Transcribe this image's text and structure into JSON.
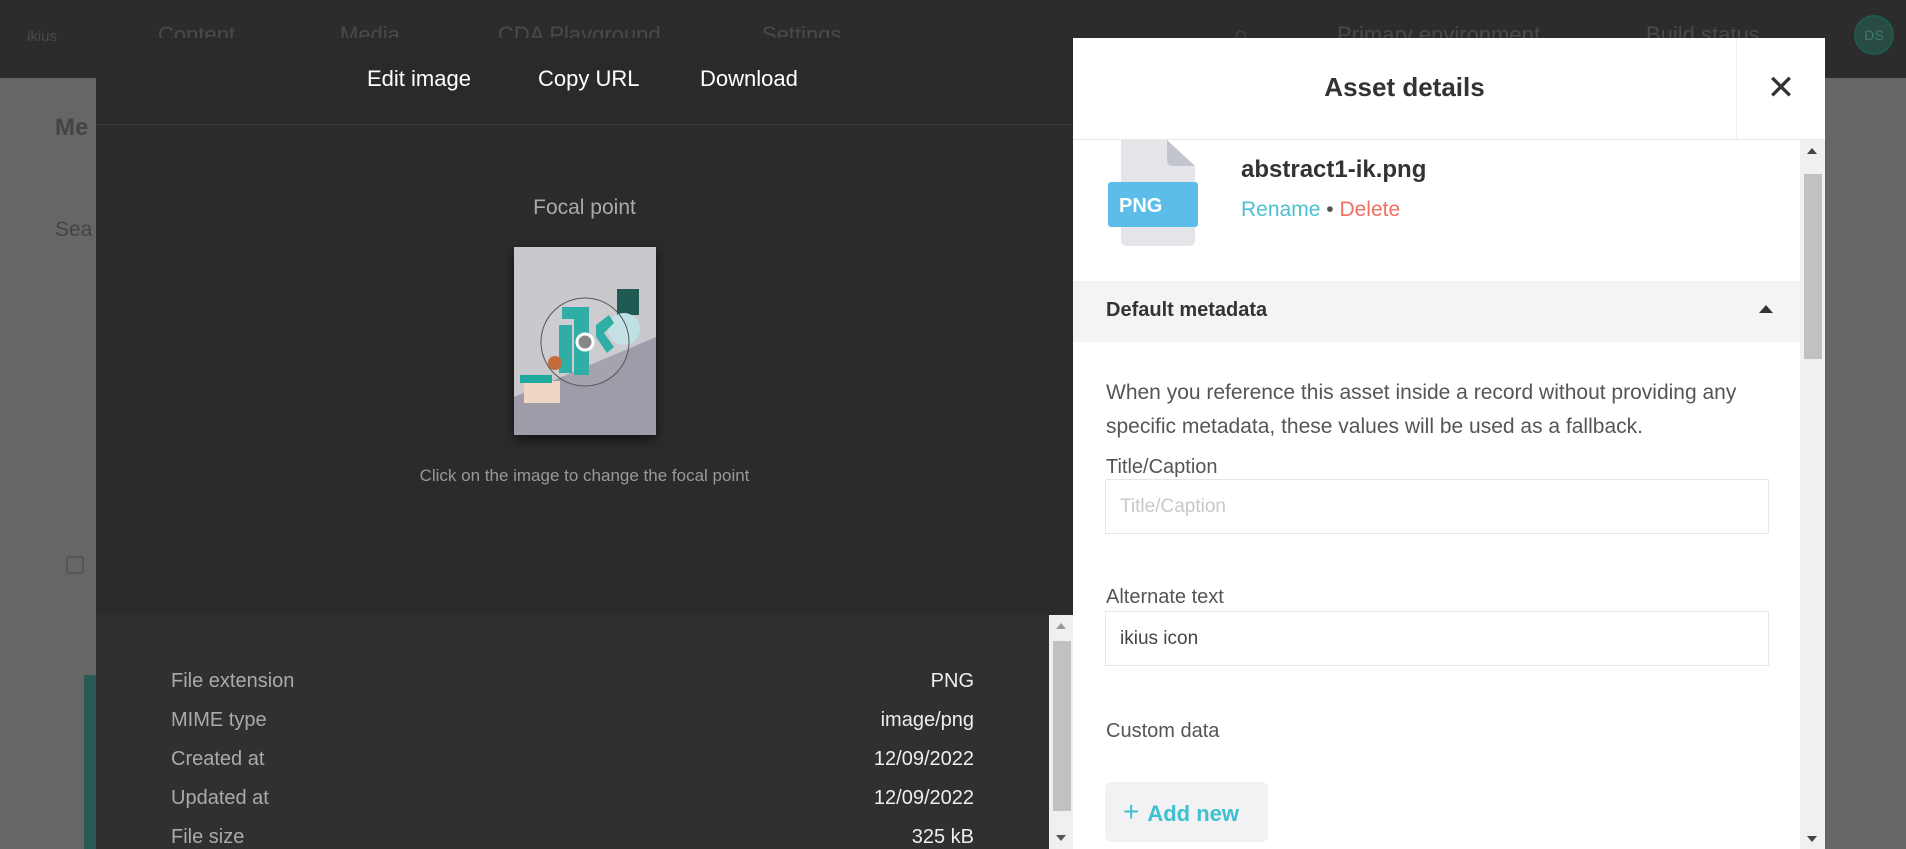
{
  "nav": {
    "logo": "ikius",
    "items": [
      "Content",
      "Media",
      "CDA Playground",
      "Settings"
    ],
    "environment": "Primary environment",
    "build_status": "Build status",
    "avatar": "DS"
  },
  "background": {
    "heading": "Me",
    "search": "Sea"
  },
  "modal": {
    "actions": {
      "edit": "Edit image",
      "copy": "Copy URL",
      "download": "Download"
    },
    "focal_label": "Focal point",
    "focal_hint": "Click on the image to change the focal point",
    "details": [
      {
        "k": "File extension",
        "v": "PNG"
      },
      {
        "k": "MIME type",
        "v": "image/png"
      },
      {
        "k": "Created at",
        "v": "12/09/2022"
      },
      {
        "k": "Updated at",
        "v": "12/09/2022"
      },
      {
        "k": "File size",
        "v": "325 kB"
      }
    ]
  },
  "panel": {
    "title": "Asset details",
    "file_badge": "PNG",
    "filename": "abstract1-ik.png",
    "rename": "Rename",
    "separator": "•",
    "delete": "Delete",
    "section": "Default metadata",
    "description": "When you reference this asset inside a record without providing any specific metadata, these values will be used as a fallback.",
    "title_label": "Title/Caption",
    "title_placeholder": "Title/Caption",
    "title_value": "",
    "alt_label": "Alternate text",
    "alt_value": "ikius icon",
    "custom_label": "Custom data",
    "add_new": "Add new"
  },
  "colors": {
    "accent": "#3ec0d0",
    "danger": "#f07060",
    "badge": "#5bbde8"
  }
}
